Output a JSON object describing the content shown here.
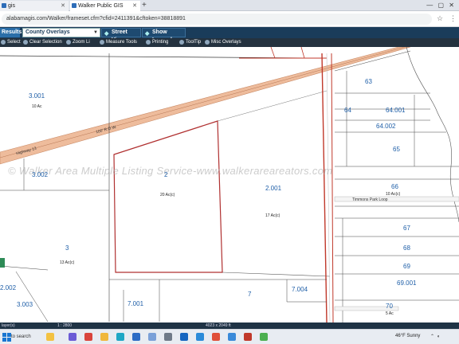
{
  "browser": {
    "tabs": [
      {
        "label": "gis"
      },
      {
        "label": "Walker Public GIS"
      }
    ],
    "new_tab_label": "+",
    "window_controls": "—  ▢  ✕",
    "url": "alabamagis.com/Walker/frameset.cfm?cfid=2411391&cftoken=38818891"
  },
  "toolbar": {
    "results_label": "Results",
    "layer_select_value": "County Overlays",
    "street_view_label": "Street View",
    "show_legend_label": "Show Legend"
  },
  "tools": [
    {
      "label": "Select"
    },
    {
      "label": "Clear Selection"
    },
    {
      "label": "Zoom Li"
    },
    {
      "label": "Measure Tools"
    },
    {
      "label": "Printing"
    },
    {
      "label": "ToolTip"
    },
    {
      "label": "Misc Overlays"
    }
  ],
  "map": {
    "watermark": "© Walker Area Multiple Listing Service-www.walkerareareators.com",
    "parcels": [
      {
        "id": "3.001",
        "acres": "10 Ac"
      },
      {
        "id": "3.002",
        "acres": ""
      },
      {
        "id": "2",
        "acres": "20 Ac(c)"
      },
      {
        "id": "2.001",
        "acres": "17 Ac(c)"
      },
      {
        "id": "3",
        "acres": "13 Ac(c)"
      },
      {
        "id": "3.003",
        "acres": ""
      },
      {
        "id": "7.001",
        "acres": ""
      },
      {
        "id": "7",
        "acres": ""
      },
      {
        "id": "7.004",
        "acres": ""
      },
      {
        "id": "63",
        "acres": ""
      },
      {
        "id": "64",
        "acres": ""
      },
      {
        "id": "64.001",
        "acres": ""
      },
      {
        "id": "64.002",
        "acres": ""
      },
      {
        "id": "65",
        "acres": ""
      },
      {
        "id": "66",
        "acres": "10 Ac(c)"
      },
      {
        "id": "67",
        "acres": ""
      },
      {
        "id": "68",
        "acres": ""
      },
      {
        "id": "69",
        "acres": ""
      },
      {
        "id": "69.001",
        "acres": ""
      },
      {
        "id": "70",
        "acres": "5 Ac"
      },
      {
        "id": "2.002",
        "acres": ""
      }
    ],
    "road_labels": {
      "highway": "Highway 13",
      "row": "100' R.O.W.",
      "timmons": "Timmons Park Loop"
    }
  },
  "status": {
    "layers": "layer(s)",
    "scale": "1 : 2800",
    "dimensions": "4023 x 2049 ft"
  },
  "taskbar": {
    "search_label": "to search",
    "weather": "46°F  Sunny"
  }
}
